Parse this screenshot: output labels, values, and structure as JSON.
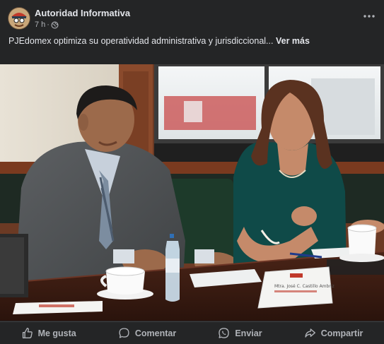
{
  "post": {
    "page_name": "Autoridad Informativa",
    "time": "7 h",
    "separator": "·",
    "audience_icon": "globe-icon",
    "more_icon": "more-horizontal-icon",
    "text": "PJEdomex optimiza su operatividad administrativa y jurisdiccional...",
    "see_more": "Ver más"
  },
  "photo": {
    "nameplate_line1": "Mtra. José C. Castillo Ambriz",
    "nameplate_line2": ""
  },
  "actions": [
    {
      "label": "Me gusta",
      "icon": "thumbs-up-icon"
    },
    {
      "label": "Comentar",
      "icon": "comment-icon"
    },
    {
      "label": "Enviar",
      "icon": "whatsapp-icon"
    },
    {
      "label": "Compartir",
      "icon": "share-icon"
    }
  ],
  "colors": {
    "background": "#242526",
    "text_primary": "#e4e6eb",
    "text_secondary": "#b0b3b8",
    "divider": "#3e4042"
  }
}
